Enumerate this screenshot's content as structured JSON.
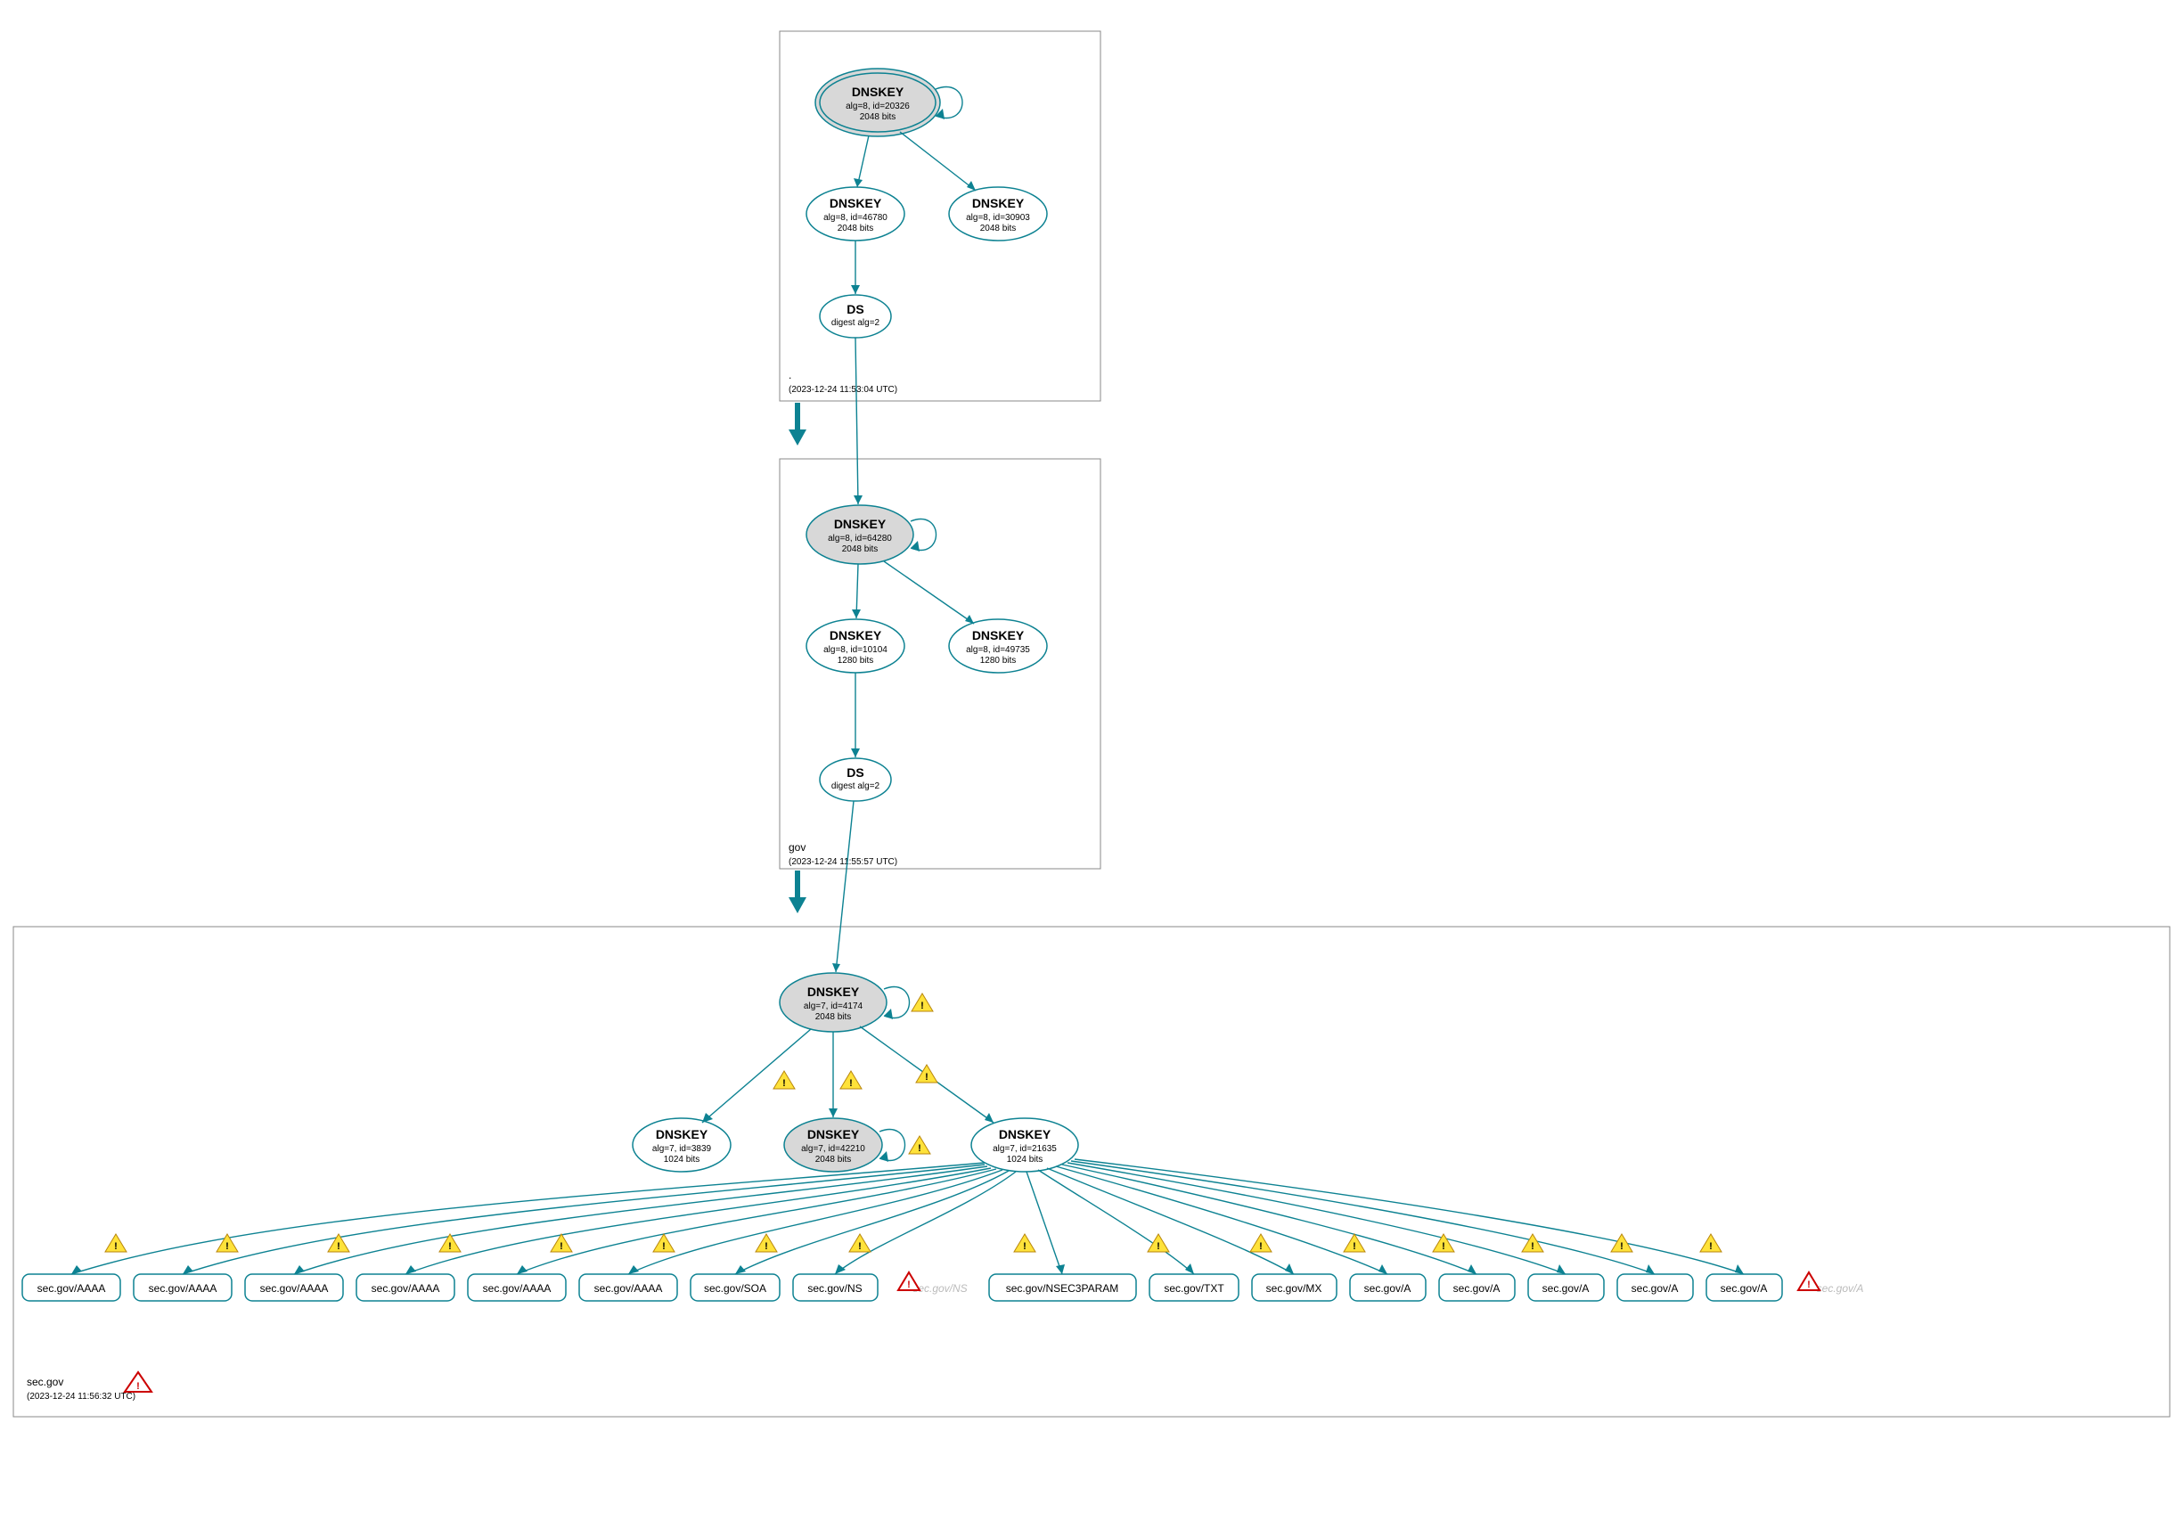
{
  "zones": {
    "root": {
      "label": ".",
      "timestamp": "(2023-12-24 11:53:04 UTC)"
    },
    "gov": {
      "label": "gov",
      "timestamp": "(2023-12-24 11:55:57 UTC)"
    },
    "secgov": {
      "label": "sec.gov",
      "timestamp": "(2023-12-24 11:56:32 UTC)"
    }
  },
  "nodes": {
    "root_ksk": {
      "title": "DNSKEY",
      "sub1": "alg=8, id=20326",
      "sub2": "2048 bits"
    },
    "root_zsk1": {
      "title": "DNSKEY",
      "sub1": "alg=8, id=46780",
      "sub2": "2048 bits"
    },
    "root_zsk2": {
      "title": "DNSKEY",
      "sub1": "alg=8, id=30903",
      "sub2": "2048 bits"
    },
    "root_ds": {
      "title": "DS",
      "sub1": "digest alg=2",
      "sub2": ""
    },
    "gov_ksk": {
      "title": "DNSKEY",
      "sub1": "alg=8, id=64280",
      "sub2": "2048 bits"
    },
    "gov_zsk1": {
      "title": "DNSKEY",
      "sub1": "alg=8, id=10104",
      "sub2": "1280 bits"
    },
    "gov_zsk2": {
      "title": "DNSKEY",
      "sub1": "alg=8, id=49735",
      "sub2": "1280 bits"
    },
    "gov_ds": {
      "title": "DS",
      "sub1": "digest alg=2",
      "sub2": ""
    },
    "sec_ksk": {
      "title": "DNSKEY",
      "sub1": "alg=7, id=4174",
      "sub2": "2048 bits"
    },
    "sec_zsk1": {
      "title": "DNSKEY",
      "sub1": "alg=7, id=3839",
      "sub2": "1024 bits"
    },
    "sec_zsk2": {
      "title": "DNSKEY",
      "sub1": "alg=7, id=42210",
      "sub2": "2048 bits"
    },
    "sec_zsk3": {
      "title": "DNSKEY",
      "sub1": "alg=7, id=21635",
      "sub2": "1024 bits"
    }
  },
  "rr": {
    "r0": "sec.gov/AAAA",
    "r1": "sec.gov/AAAA",
    "r2": "sec.gov/AAAA",
    "r3": "sec.gov/AAAA",
    "r4": "sec.gov/AAAA",
    "r5": "sec.gov/AAAA",
    "r6": "sec.gov/SOA",
    "r7": "sec.gov/NS",
    "r8": "sec.gov/NS",
    "r9": "sec.gov/NSEC3PARAM",
    "r10": "sec.gov/TXT",
    "r11": "sec.gov/MX",
    "r12": "sec.gov/A",
    "r13": "sec.gov/A",
    "r14": "sec.gov/A",
    "r15": "sec.gov/A",
    "r16": "sec.gov/A",
    "r17": "sec.gov/A"
  }
}
